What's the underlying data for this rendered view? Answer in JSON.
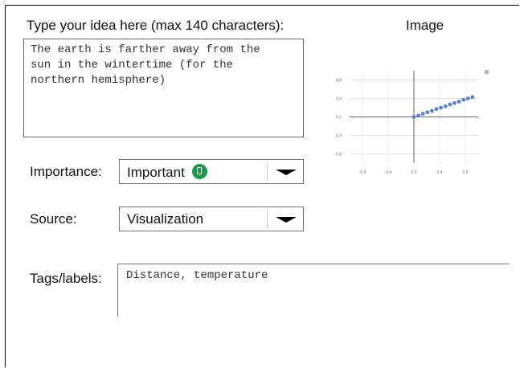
{
  "idea": {
    "label": "Type your idea here (max 140 characters):",
    "text": "The earth is farther away from the\nsun in the wintertime (for the\nnorthern hemisphere)"
  },
  "image_panel": {
    "label": "Image"
  },
  "importance": {
    "label": "Importance:",
    "value": "Important"
  },
  "source": {
    "label": "Source:",
    "value": "Visualization"
  },
  "tags": {
    "label": "Tags/labels:",
    "value": "Distance, temperature"
  },
  "chart_data": {
    "type": "scatter",
    "x_ticks": [
      "-0.8",
      "-0.4",
      "0.0",
      "0.4",
      "0.8"
    ],
    "y_ticks": [
      "0.8",
      "0.4",
      "0.0",
      "-0.4",
      "-0.8"
    ],
    "xlim": [
      -1.0,
      1.0
    ],
    "ylim": [
      -1.0,
      1.0
    ],
    "grid": true,
    "series_color": "#5b7fd0",
    "x": [
      0.0,
      0.07,
      0.14,
      0.21,
      0.28,
      0.35,
      0.42,
      0.49,
      0.56,
      0.63,
      0.7,
      0.77,
      0.84,
      0.91
    ],
    "y": [
      0.0,
      0.03,
      0.07,
      0.1,
      0.13,
      0.17,
      0.2,
      0.23,
      0.27,
      0.3,
      0.33,
      0.37,
      0.4,
      0.43
    ]
  }
}
